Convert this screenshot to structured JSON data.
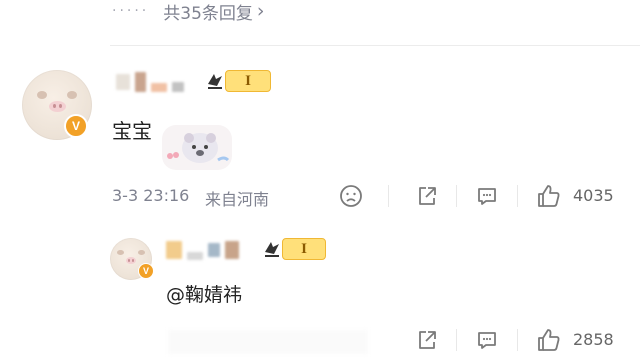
{
  "replies_link": {
    "dots": "·····",
    "text": "共35条回复",
    "arrow": "›"
  },
  "comments": [
    {
      "text": "宝宝",
      "timestamp": "3-3 23:16",
      "source": "来自河南",
      "level": "I",
      "likes": "4035",
      "icons": {
        "emoji": "sad-face-icon",
        "share": "share-icon",
        "comment": "comment-icon",
        "like": "thumbs-up-icon"
      }
    },
    {
      "text": "@鞠婧祎",
      "level": "I",
      "likes": "2858",
      "icons": {
        "share": "share-icon",
        "comment": "comment-icon",
        "like": "thumbs-up-icon"
      }
    }
  ],
  "colors": {
    "verify_badge": "#f2a127",
    "level_badge": "#ffe07a",
    "icon": "#7a7a7a",
    "muted_text": "#7f8290"
  }
}
